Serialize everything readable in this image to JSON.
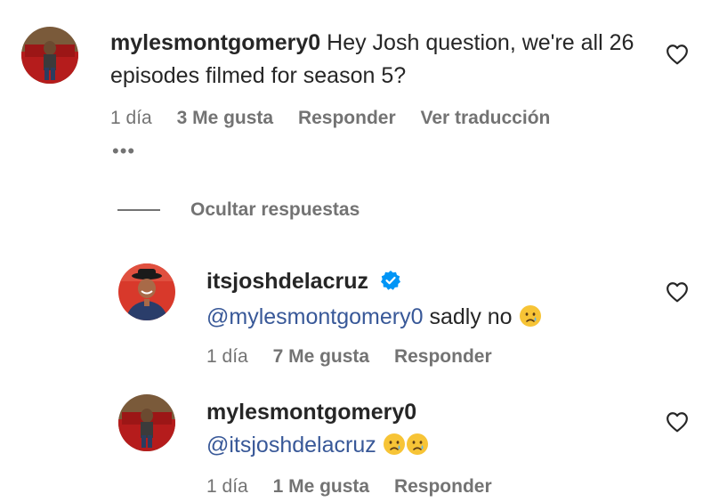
{
  "comment": {
    "username": "mylesmontgomery0",
    "text": "Hey Josh question, we're all 26 episodes filmed for season 5?",
    "time": "1 día",
    "likes": "3 Me gusta",
    "reply": "Responder",
    "translate": "Ver traducción",
    "more": "•••"
  },
  "hide_replies": "Ocultar respuestas",
  "replies": [
    {
      "username": "itsjoshdelacruz",
      "mention": "@mylesmontgomery0",
      "text": " sadly no",
      "time": "1 día",
      "likes": "7 Me gusta",
      "reply": "Responder",
      "verified": true
    },
    {
      "username": "mylesmontgomery0",
      "mention": "@itsjoshdelacruz",
      "text": "",
      "time": "1 día",
      "likes": "1 Me gusta",
      "reply": "Responder"
    }
  ],
  "colors": {
    "text": "#262626",
    "muted": "#737373",
    "mention": "#385898",
    "verified": "#0095f6"
  },
  "icons": {
    "like": "heart-icon",
    "verified": "verified-badge-icon",
    "emoji": "crying-face-icon"
  }
}
